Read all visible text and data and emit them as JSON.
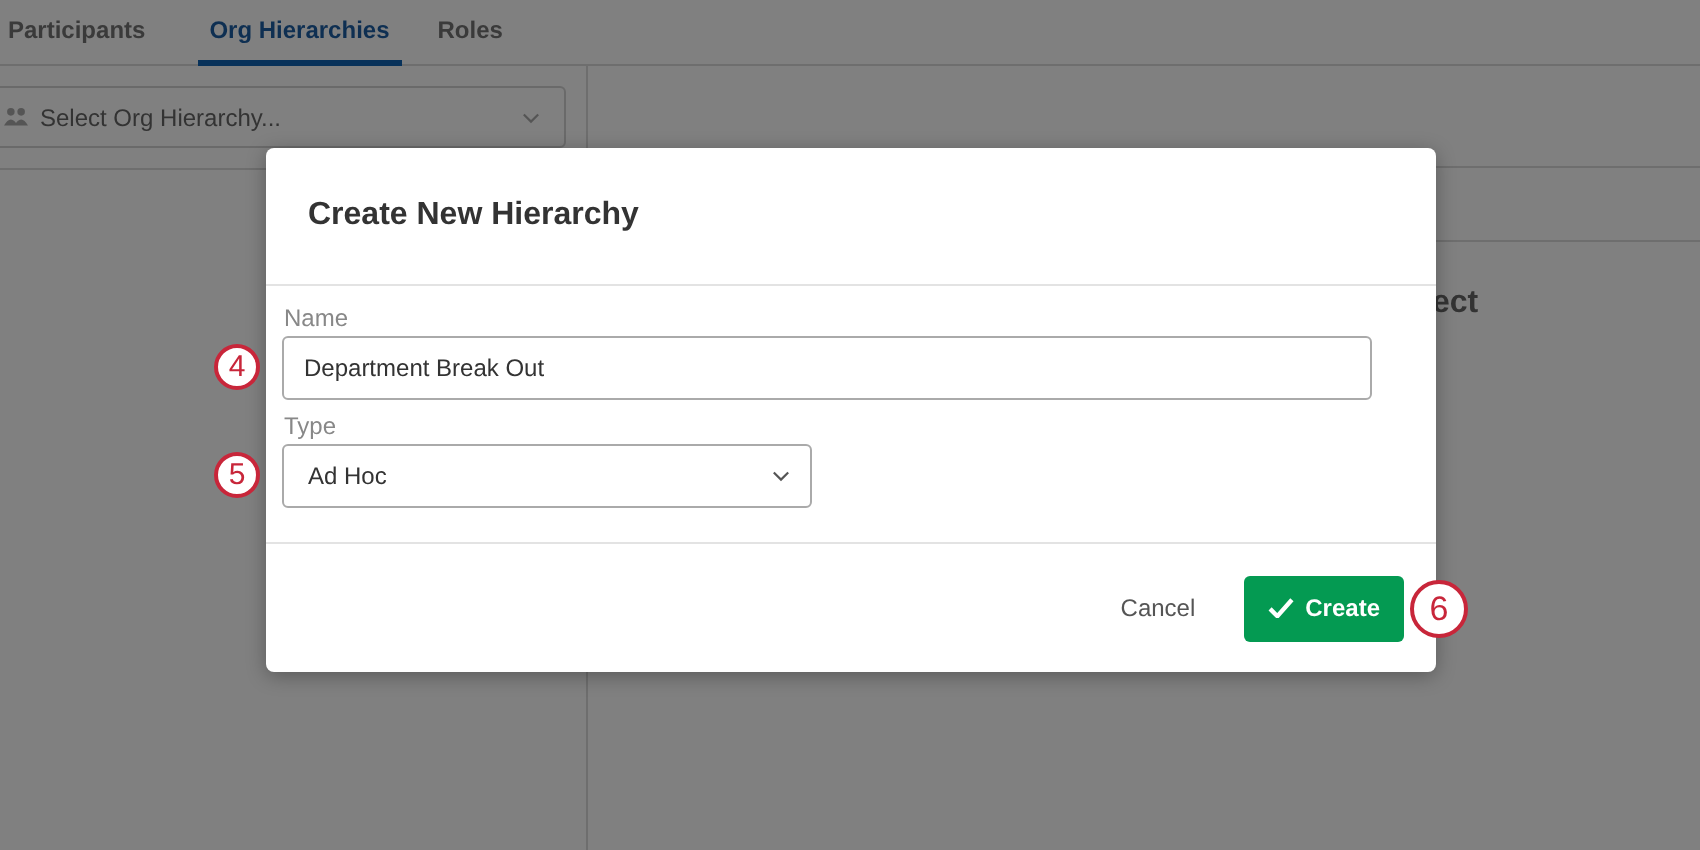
{
  "tabs": [
    {
      "label": "Participants",
      "selected": false
    },
    {
      "label": "Org Hierarchies",
      "selected": true
    },
    {
      "label": "Roles",
      "selected": false
    }
  ],
  "hierarchy_select": {
    "placeholder": "Select Org Hierarchy..."
  },
  "background_heading": "ect",
  "dialog": {
    "title": "Create New Hierarchy",
    "fields": [
      {
        "kind": "text",
        "label": "Name",
        "value": "Department Break Out",
        "step": "4"
      },
      {
        "kind": "select",
        "label": "Type",
        "value": "Ad Hoc",
        "step": "5"
      }
    ],
    "cancel": "Cancel",
    "create": "Create",
    "create_step": "6"
  }
}
